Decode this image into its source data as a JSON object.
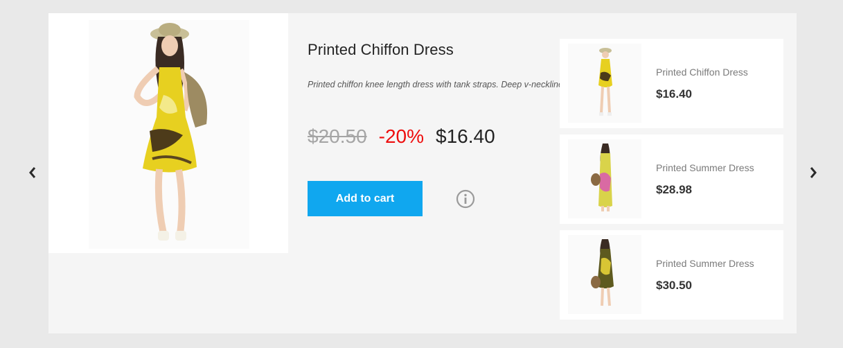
{
  "product": {
    "title": "Printed Chiffon Dress",
    "description": "Printed chiffon knee length dress with tank straps. Deep v-neckline.",
    "old_price": "$20.50",
    "discount": "-20%",
    "price": "$16.40",
    "add_to_cart_label": "Add to cart"
  },
  "related": [
    {
      "name": "Printed Chiffon Dress",
      "price": "$16.40"
    },
    {
      "name": "Printed Summer Dress",
      "price": "$28.98"
    },
    {
      "name": "Printed Summer Dress",
      "price": "$30.50"
    }
  ],
  "icons": {
    "prev": "chevron-left-icon",
    "next": "chevron-right-icon",
    "info": "info-circle-icon"
  },
  "colors": {
    "accent": "#10a7ef",
    "discount": "#ee0d0d",
    "old_price": "#a5a5a5"
  }
}
